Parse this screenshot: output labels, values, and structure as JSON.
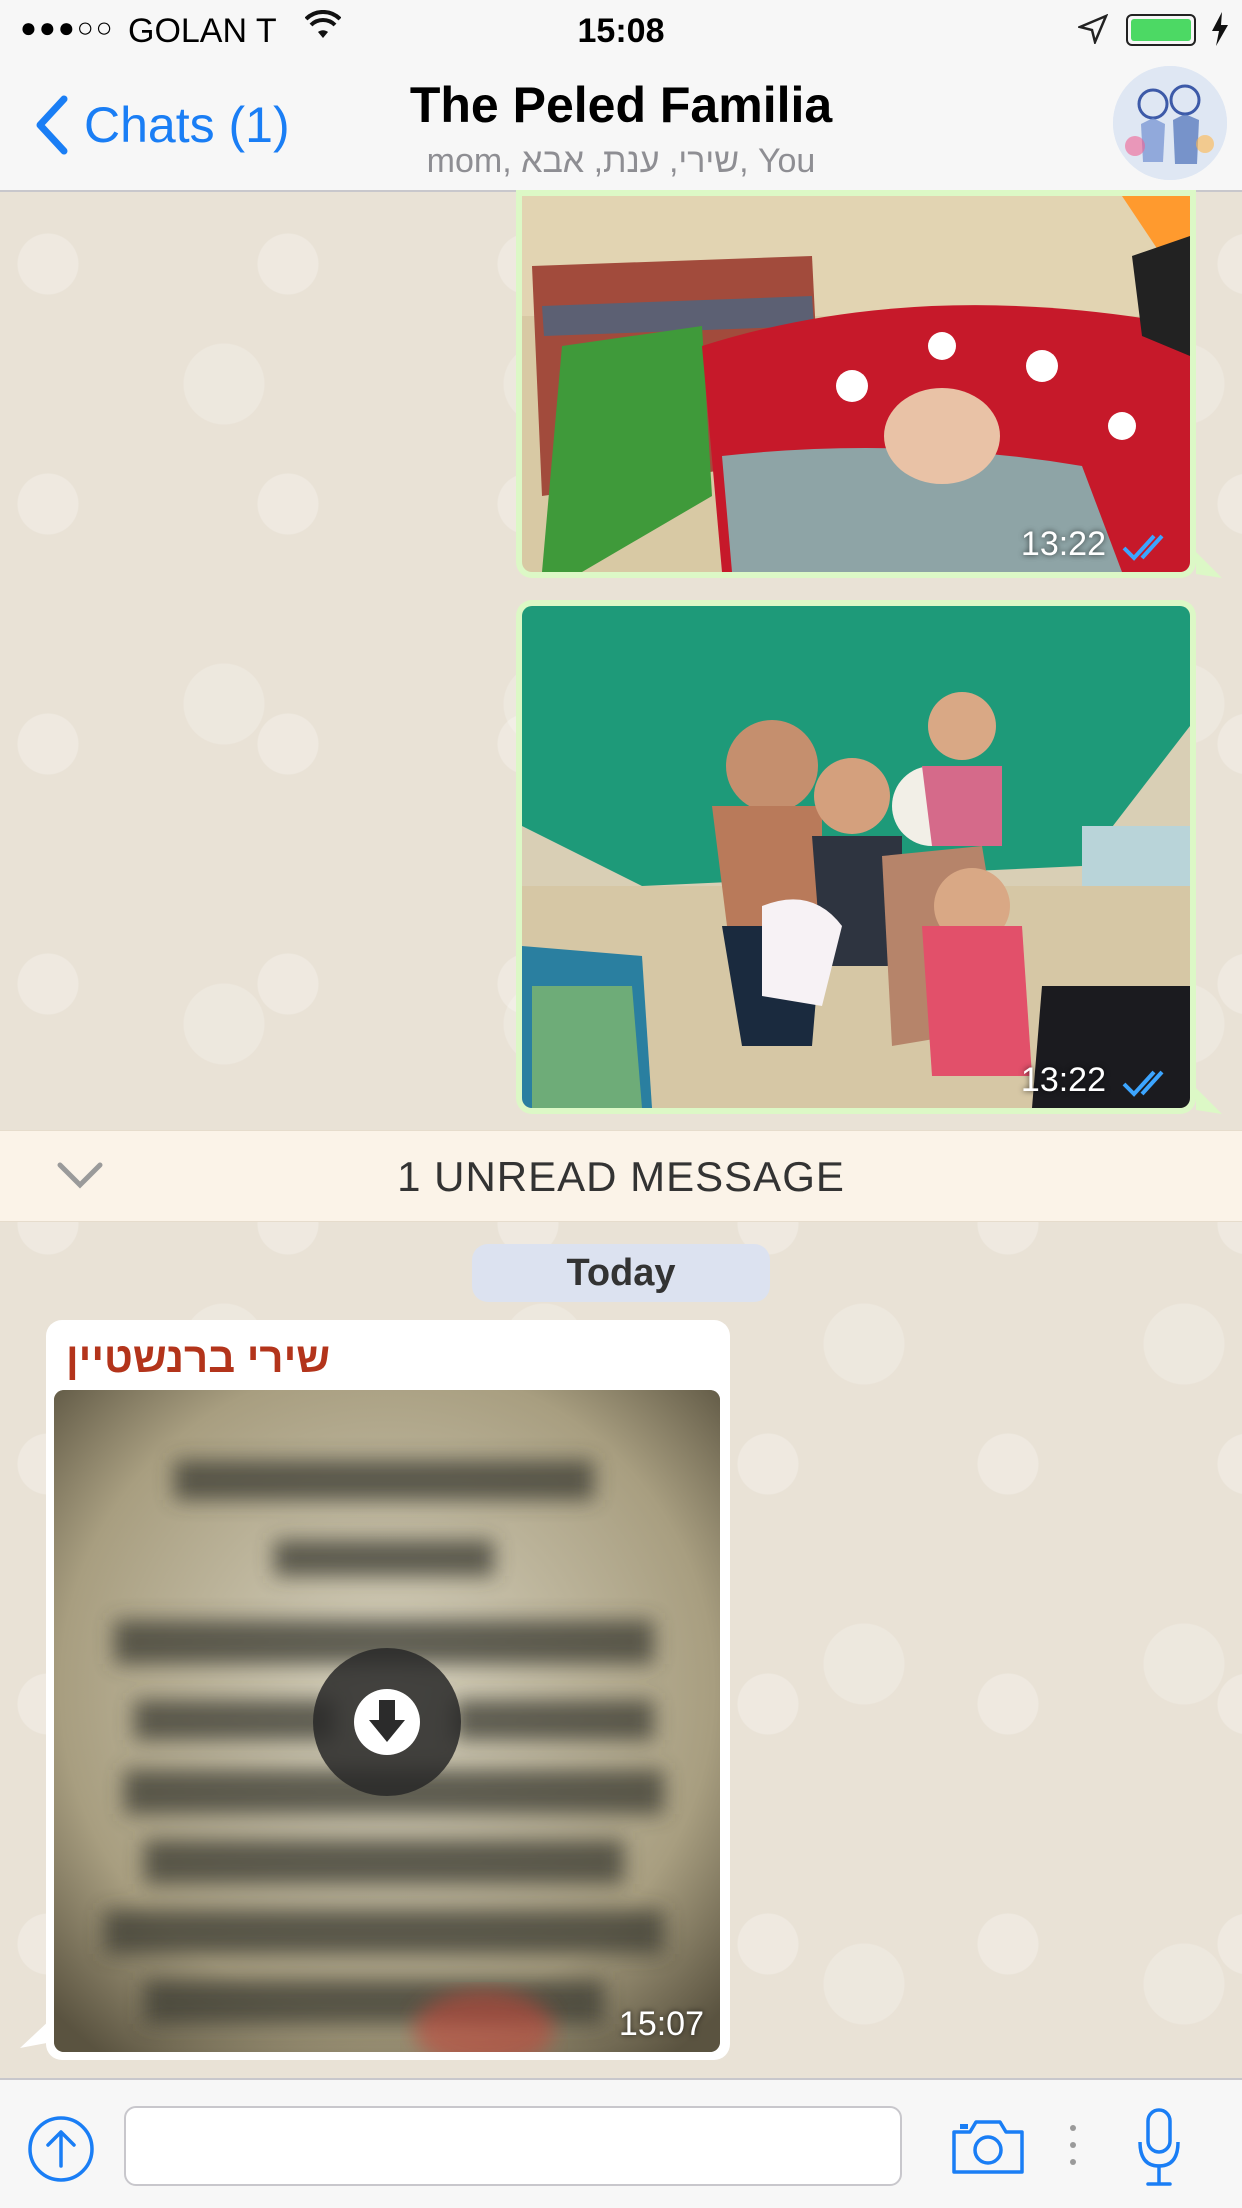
{
  "status_bar": {
    "signal": "●●●○○",
    "carrier": "GOLAN T",
    "time": "15:08",
    "battery_color": "#4cd964"
  },
  "nav": {
    "back_label": "Chats (1)",
    "title": "The Peled Familia",
    "subtitle": "mom, שירי, ענת, אבא, You",
    "accent_color": "#1a7ef5"
  },
  "messages": [
    {
      "direction": "outgoing",
      "type": "photo",
      "time": "13:22",
      "status_icon": "double-check-icon"
    },
    {
      "direction": "outgoing",
      "type": "photo",
      "time": "13:22",
      "status_icon": "double-check-icon"
    }
  ],
  "unread_bar": {
    "label": "1 UNREAD MESSAGE",
    "icon": "chevron-down-icon"
  },
  "date_chip": {
    "label": "Today"
  },
  "incoming": {
    "sender": "שירי ברנשטיין",
    "sender_color": "#b3341b",
    "type": "photo",
    "time": "15:07",
    "action_icon": "download-icon"
  },
  "input_bar": {
    "placeholder": "",
    "icons": [
      "upload-icon",
      "camera-icon",
      "microphone-icon"
    ]
  }
}
